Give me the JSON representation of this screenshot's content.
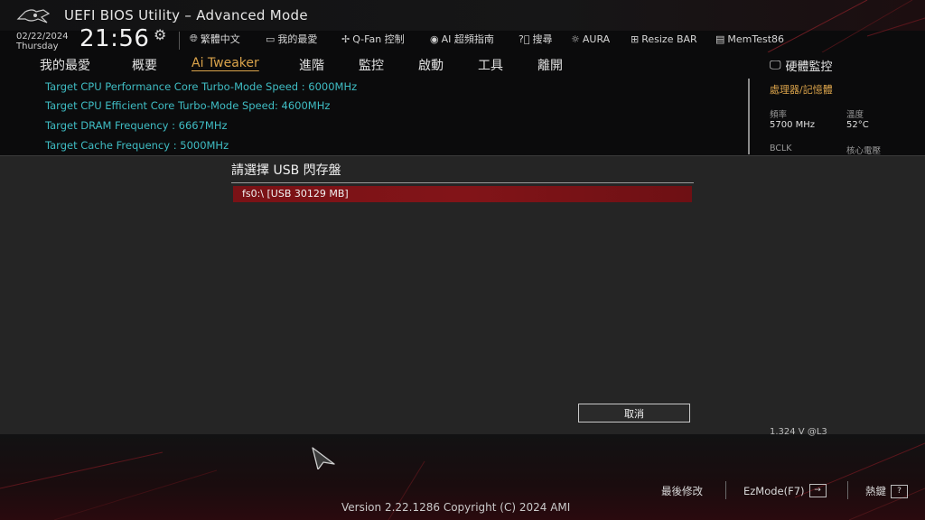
{
  "header": {
    "title": "UEFI BIOS Utility – Advanced Mode",
    "date": "02/22/2024",
    "weekday": "Thursday",
    "time": "21:56",
    "tools": [
      {
        "label": "繁體中文",
        "icon": "globe-icon"
      },
      {
        "label": "我的最愛",
        "icon": "favorite-icon"
      },
      {
        "label": "Q-Fan 控制",
        "icon": "fan-icon"
      },
      {
        "label": "AI 超頻指南",
        "icon": "ai-icon"
      },
      {
        "label": "搜尋",
        "icon": "search-icon"
      },
      {
        "label": "AURA",
        "icon": "aura-icon"
      },
      {
        "label": "Resize BAR",
        "icon": "resize-bar-icon"
      },
      {
        "label": "MemTest86",
        "icon": "memtest-icon"
      }
    ]
  },
  "nav": {
    "items": [
      {
        "label": "我的最愛"
      },
      {
        "label": "概要"
      },
      {
        "label": "Ai Tweaker",
        "active": true
      },
      {
        "label": "進階"
      },
      {
        "label": "監控"
      },
      {
        "label": "啟動"
      },
      {
        "label": "工具"
      },
      {
        "label": "離開"
      }
    ]
  },
  "settings": [
    "Target CPU Performance Core Turbo-Mode Speed : 6000MHz",
    "Target CPU Efficient Core Turbo-Mode Speed: 4600MHz",
    "Target DRAM Frequency : 6667MHz",
    "Target Cache Frequency : 5000MHz"
  ],
  "hardware_monitor": {
    "title": "硬體監控",
    "section": "處理器/記憶體",
    "freq_label": "頻率",
    "freq_value": "5700 MHz",
    "temp_label": "溫度",
    "temp_value": "52°C",
    "bclk_label": "BCLK",
    "vcore_label": "核心電壓",
    "partial_value": "1.324 V @L3"
  },
  "dialog": {
    "title": "請選擇 USB 閃存盤",
    "items": [
      "fs0:\\ [USB 30129 MB]"
    ],
    "cancel_label": "取消"
  },
  "footer": {
    "last_modified": "最後修改",
    "ezmode": "EzMode(F7)",
    "hotkeys": "熱鍵",
    "hotkey_symbol": "?",
    "version": "Version 2.22.1286 Copyright (C) 2024 AMI"
  },
  "colors": {
    "accent": "#d9a24a",
    "setting_text": "#3fbdc4",
    "selection": "#821418"
  }
}
